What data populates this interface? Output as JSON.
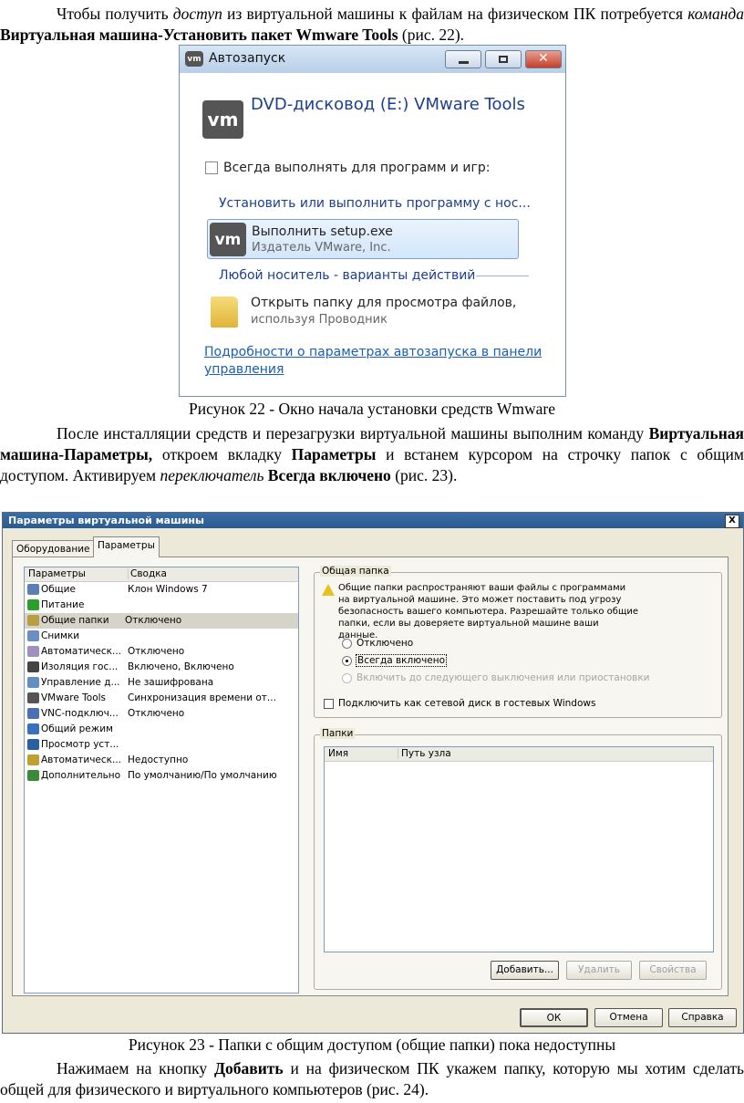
{
  "para1": {
    "a": "Чтобы получить ",
    "b": "доступ",
    "c": " из виртуальной машины к файлам на физическом ПК потребуется ",
    "d": "команда",
    "e": " ",
    "f": "Виртуальная машина-Установить пакет Wmware Tools",
    "g": " (рис. 22)."
  },
  "autoplay": {
    "title": "Автозапуск",
    "vm_logo": "vm",
    "drive": "DVD-дисковод (E:) VMware Tools",
    "always_checkbox": "Всегда выполнять для программ и игр:",
    "install_header": "Установить или выполнить программу с нос...",
    "run_title": "Выполнить setup.exe",
    "run_sub": "Издатель VMware, Inc.",
    "any_media": "Любой носитель - варианты действий",
    "open_folder_title": "Открыть папку для просмотра файлов,",
    "open_folder_sub": "используя Проводник",
    "details_link_1": "Подробности о параметрах автозапуска в панели",
    "details_link_2": "управления"
  },
  "caption22": "Рисунок 22 - Окно начала установки средств Wmware",
  "para2": {
    "a": "После инсталляции средств и перезагрузки виртуальной машины выполним команду ",
    "b": "Виртуальная машина-Параметры,",
    "c": " откроем вкладку ",
    "d": "Параметры",
    "e": " и встанем курсором на строчку папок с общим доступом. Активируем ",
    "f": "переключатель",
    "g": " ",
    "h": "Всегда включено",
    "i": " (рис. 23)."
  },
  "vmdialog": {
    "title": "Параметры виртуальной машины",
    "close": "X",
    "tabs": [
      "Оборудование",
      "Параметры"
    ],
    "list_headers": [
      "Параметры",
      "Сводка"
    ],
    "rows": [
      {
        "name": "Общие",
        "summary": "Клон Windows 7",
        "icon": "#5a7fb5"
      },
      {
        "name": "Питание",
        "summary": "",
        "icon": "#2aa02a"
      },
      {
        "name": "Общие папки",
        "summary": "Отключено",
        "icon": "#b8a040"
      },
      {
        "name": "Снимки",
        "summary": "",
        "icon": "#6a8fc0"
      },
      {
        "name": "Автоматическ...",
        "summary": "Отключено",
        "icon": "#a090c0"
      },
      {
        "name": "Изоляция гос...",
        "summary": "Включено, Включено",
        "icon": "#444444"
      },
      {
        "name": "Управление д...",
        "summary": "Не зашифрована",
        "icon": "#6090c0"
      },
      {
        "name": "VMware Tools",
        "summary": "Синхронизация времени от...",
        "icon": "#555555"
      },
      {
        "name": "VNC-подключ...",
        "summary": "Отключено",
        "icon": "#4a70b0"
      },
      {
        "name": "Общий режим",
        "summary": "",
        "icon": "#3a70c0"
      },
      {
        "name": "Просмотр уст...",
        "summary": "",
        "icon": "#2a5fa0"
      },
      {
        "name": "Автоматическ...",
        "summary": "Недоступно",
        "icon": "#c0a030"
      },
      {
        "name": "Дополнительно",
        "summary": "По умолчанию/По умолчанию",
        "icon": "#3a8a3a"
      }
    ],
    "shared_group": "Общая папка",
    "warning": "Общие папки распространяют ваши файлы с программами на виртуальной машине. Это может поставить под угрозу безопасность вашего компьютера. Разрешайте только общие папки, если вы доверяете виртуальной машине ваши данные.",
    "radio_off": "Отключено",
    "radio_always": "Всегда включено",
    "radio_until": "Включить до следующего выключения или приостановки",
    "map_drive": "Подключить как сетевой диск в гостевых Windows",
    "folders_group": "Папки",
    "folder_headers": [
      "Имя",
      "Путь узла"
    ],
    "btn_add": "Добавить...",
    "btn_remove": "Удалить",
    "btn_props": "Свойства",
    "btn_ok": "ОК",
    "btn_cancel": "Отмена",
    "btn_help": "Справка"
  },
  "caption23": "Рисунок 23 - Папки с общим доступом (общие папки) пока недоступны",
  "para3": {
    "a": "Нажимаем на кнопку ",
    "b": "Добавить",
    "c": " и на физическом ПК укажем папку, которую мы хотим сделать общей для физического и виртуального компьютеров (рис. 24)."
  }
}
